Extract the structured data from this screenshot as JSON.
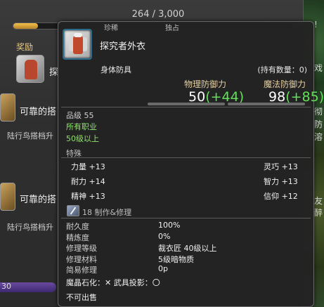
{
  "background": {
    "progress_text": "264 / 3,000",
    "progress_fraction": 0.088,
    "reward_label": "奖励",
    "reward_item_partial": "探",
    "entries": [
      {
        "title": "可靠的搭",
        "subtitle": "陆行鸟搭档升"
      },
      {
        "title": "可靠的搭",
        "subtitle": "陆行鸟搭档升"
      }
    ],
    "bottom_text": "30",
    "right_edge_chars": [
      "!",
      "戏",
      "彻",
      "防",
      "溶",
      "友",
      "醉"
    ]
  },
  "tooltip": {
    "tags": [
      "珍稀",
      "独占"
    ],
    "item_name": "探究者外衣",
    "category": "身体防具",
    "owned": "(持有数量：0)",
    "physical_label": "物理防御力",
    "physical_value": "50",
    "physical_bonus": "(+44)",
    "magic_label": "魔法防御力",
    "magic_value": "98",
    "magic_bonus": "(+85)",
    "item_level": "品级 55",
    "class_req": "所有职业",
    "level_req": "50级以上",
    "bonus_section": "特殊",
    "attributes": [
      {
        "name": "力量",
        "value": "+13"
      },
      {
        "name": "灵巧",
        "value": "+13"
      },
      {
        "name": "耐力",
        "value": "+14"
      },
      {
        "name": "智力",
        "value": "+13"
      },
      {
        "name": "精神",
        "value": "+13"
      },
      {
        "name": "信仰",
        "value": "+12"
      }
    ],
    "repair_section": "18 制作&修理",
    "repair_rows": [
      {
        "label": "耐久度",
        "value": "100%"
      },
      {
        "label": "精炼度",
        "value": "0%"
      },
      {
        "label": "修理等级",
        "value": "裁衣匠 40级以上"
      },
      {
        "label": "修理材料",
        "value": "5级暗物质"
      },
      {
        "label": "简易修理",
        "value": "0p"
      }
    ],
    "flags": "魔晶石化：✕   武具投影：〇",
    "unsellable": "不可出售"
  }
}
